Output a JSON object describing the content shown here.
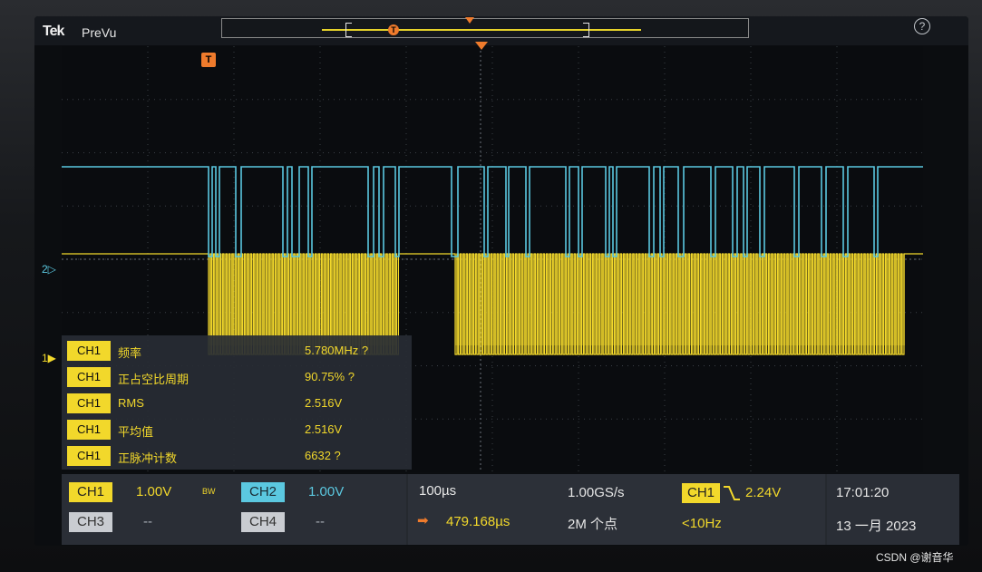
{
  "topbar": {
    "logo": "Tek",
    "mode": "PreVu",
    "overview_trigger_marker": "T",
    "help_label": "?"
  },
  "markers": {
    "ch1_marker": "1▶",
    "ch2_marker": "2▷",
    "trigger_marker": "T"
  },
  "measurements": [
    {
      "channel": "CH1",
      "name": "频率",
      "value": "5.780MHz ?"
    },
    {
      "channel": "CH1",
      "name": "正占空比周期",
      "value": "90.75% ?"
    },
    {
      "channel": "CH1",
      "name": "RMS",
      "value": "2.516V"
    },
    {
      "channel": "CH1",
      "name": "平均值",
      "value": "2.516V"
    },
    {
      "channel": "CH1",
      "name": "正脉冲计数",
      "value": "6632 ?"
    }
  ],
  "channels": {
    "ch1": {
      "label": "CH1",
      "scale": "1.00V"
    },
    "bw": "BW",
    "ch2": {
      "label": "CH2",
      "scale": "1.00V"
    },
    "ch3": {
      "label": "CH3",
      "scale": "--"
    },
    "ch4": {
      "label": "CH4",
      "scale": "--"
    }
  },
  "timebase": {
    "scale": "100µs",
    "position": "479.168µs",
    "sample_rate": "1.00GS/s",
    "record_length": "2M 个点"
  },
  "trigger": {
    "source": "CH1",
    "slope_icon": "falling-edge-icon",
    "level": "2.24V",
    "frequency": "<10Hz"
  },
  "clock": {
    "time": "17:01:20",
    "date": "13 一月 2023"
  },
  "watermark": "CSDN @谢音华",
  "colors": {
    "ch1": "#f2d82b",
    "ch2": "#5bc8e0",
    "trigger": "#ef7b2c"
  }
}
